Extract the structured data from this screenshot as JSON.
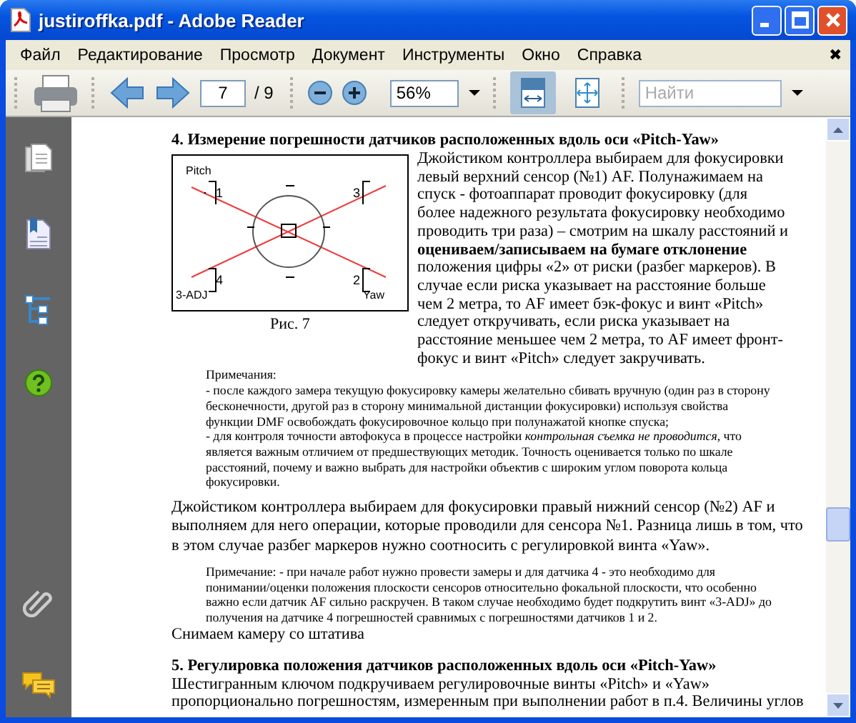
{
  "window": {
    "title": "justiroffka.pdf - Adobe Reader"
  },
  "menu": {
    "items": [
      "Файл",
      "Редактирование",
      "Просмотр",
      "Документ",
      "Инструменты",
      "Окно",
      "Справка"
    ],
    "close": "✖"
  },
  "toolbar": {
    "page": "7",
    "page_total": "/ 9",
    "zoom": "56%",
    "search_placeholder": "Найти",
    "view_buttons": [
      {
        "kind": "fit-width",
        "selected": true
      },
      {
        "kind": "fit-page",
        "selected": false
      }
    ]
  },
  "document": {
    "blocks": [
      {
        "kind": "heading",
        "text": "4.  Измерение погрешности датчиков расположенных вдоль оси «Pitch-Yaw»"
      },
      {
        "kind": "figure_text",
        "figure": {
          "labels": [
            "Pitch",
            "1",
            "3",
            "4",
            "2",
            "3-ADJ",
            "Yaw"
          ],
          "caption": "Рис. 7"
        },
        "lines": [
          "Джойстиком контроллера выбираем для фокусировки",
          "левый верхний сенсор (№1) AF. Полунажимаем на",
          "спуск -  фотоаппарат проводит фокусировку (для",
          "более надежного результата фокусировку необходимо",
          "проводить три раза) – смотрим на шкалу расстояний и",
          "**оцениваем/записываем на бумаге отклонение**",
          "положения цифры «2» от риски (разбег маркеров). В",
          "случае если риска указывает на расстояние больше",
          "чем 2 метра, то AF имеет бэк-фокус и винт «Pitch»",
          "следует откручивать, если  риска указывает на",
          "расстояние меньшее чем 2 метра, то AF имеет фронт-",
          "фокус и винт «Pitch» следует закручивать."
        ]
      },
      {
        "kind": "note",
        "lines": [
          "Примечания:",
          "- после каждого замера текущую фокусировку камеры желательно сбивать вручную (один раз в сторону",
          "бесконечности, другой раз в сторону минимальной дистанции фокусировки)  используя свойства",
          "функции DMF освобождать фокусировочное кольцо при полунажатой кнопке спуска;",
          "- для контроля точности автофокуса в процессе настройки *контрольная съемка не проводится*, что",
          "является важным отличием от предшествующих методик. Точность оценивается только по шкале",
          "расстояний, почему и важно выбрать для настройки объектив с широким углом поворота кольца",
          "фокусировки."
        ]
      },
      {
        "kind": "paragraph",
        "lines": [
          "Джойстиком контроллера выбираем для фокусировки правый нижний сенсор (№2) AF и",
          "выполняем для него операции, которые проводили для сенсора №1. Разница лишь в том, что",
          "в этом случае разбег маркеров нужно соотносить с регулировкой винта «Yaw»."
        ]
      },
      {
        "kind": "note",
        "lines": [
          "Примечание: - при начале работ нужно провести замеры и для датчика 4 - это необходимо для",
          "понимании/оценки положения плоскости сенсоров относительно фокальной плоскости, что особенно",
          "важно если датчик AF сильно раскручен. В таком случае необходимо будет подкрутить винт «3-ADJ» до",
          "получения на датчике 4  погрешностей сравнимых с погрешностями датчиков 1 и 2."
        ]
      },
      {
        "kind": "line",
        "lines": [
          "Снимаем камеру со штатива"
        ]
      },
      {
        "kind": "heading",
        "text": "5. Регулировка положения датчиков расположенных вдоль оси «Pitch-Yaw»"
      },
      {
        "kind": "line",
        "lines": [
          "Шестигранным ключом подкручиваем регулировочные винты «Pitch» и «Yaw»",
          "пропорционально погрешностям, измеренным при выполнении работ в п.4. Величины углов"
        ]
      }
    ]
  }
}
